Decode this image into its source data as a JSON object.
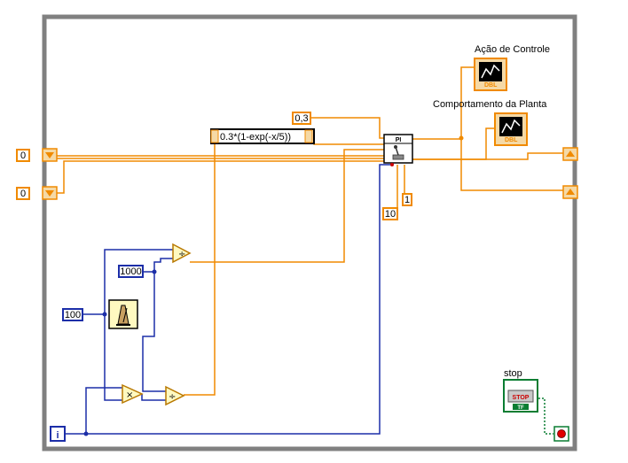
{
  "diagram": {
    "constants": {
      "left_input_1": "0",
      "left_input_2": "0",
      "setpoint": "0,3",
      "divisor": "1000",
      "wait_ms": "100",
      "kp": "10",
      "ti": "1"
    },
    "formula_node": {
      "expression": "0.3*(1-exp(-x/5))"
    },
    "pi_block": {
      "label": "PI"
    },
    "indicators": {
      "control_action": "Ação de Controle",
      "plant_behavior": "Comportamento da Planta",
      "type_tag": "DBL"
    },
    "stop_control": {
      "label": "stop",
      "button_text": "STOP",
      "type_tag": "TF"
    },
    "iteration_terminal": "i",
    "operators": {
      "divide": "÷",
      "multiply": "×"
    },
    "colors": {
      "loop_border": "#808080",
      "numeric_wire": "#f08a00",
      "integer_wire": "#1c2ea8",
      "boolean_wire": "#0a7d32"
    }
  }
}
